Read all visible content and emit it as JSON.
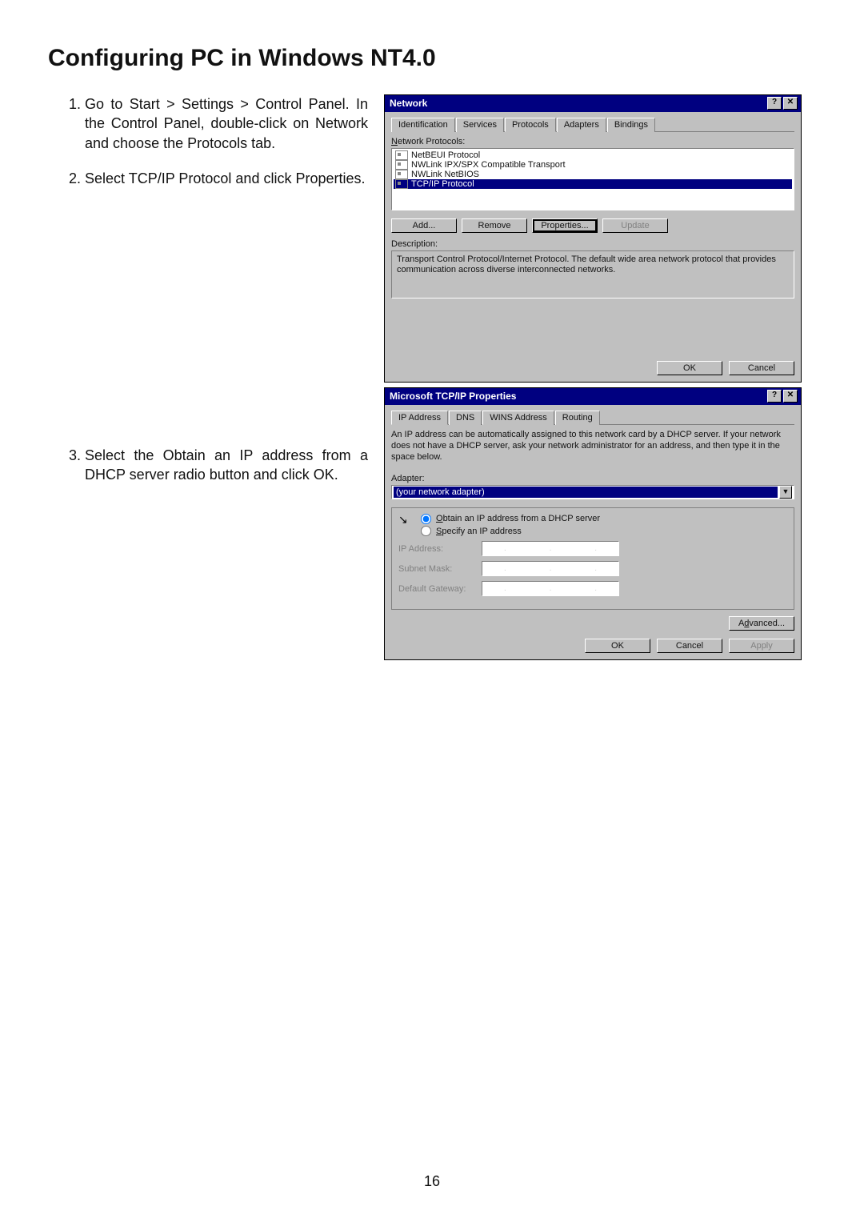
{
  "title": "Configuring PC in Windows NT4.0",
  "steps": [
    "Go to Start > Settings > Control Panel. In the Control Panel, double-click on Network and choose the Protocols tab.",
    "Select TCP/IP Protocol and click Properties.",
    "Select the Obtain an IP address from a DHCP server radio button and click OK."
  ],
  "page_number": "16",
  "network_dialog": {
    "title": "Network",
    "help_btn": "?",
    "close_btn": "✕",
    "tabs": [
      "Identification",
      "Services",
      "Protocols",
      "Adapters",
      "Bindings"
    ],
    "active_tab": 2,
    "list_label": "Network Protocols:",
    "protocols": [
      "NetBEUI Protocol",
      "NWLink IPX/SPX Compatible Transport",
      "NWLink NetBIOS",
      "TCP/IP Protocol"
    ],
    "selected_protocol": 3,
    "buttons": {
      "add": "Add...",
      "remove": "Remove",
      "properties": "Properties...",
      "update": "Update"
    },
    "desc_label": "Description:",
    "desc_text": "Transport Control Protocol/Internet Protocol. The default wide area network protocol that provides communication across diverse interconnected networks.",
    "ok": "OK",
    "cancel": "Cancel"
  },
  "tcpip_dialog": {
    "title": "Microsoft TCP/IP Properties",
    "help_btn": "?",
    "close_btn": "✕",
    "tabs": [
      "IP Address",
      "DNS",
      "WINS Address",
      "Routing"
    ],
    "active_tab": 0,
    "info_text": "An IP address can be automatically assigned to this network card by a DHCP server. If your network does not have a DHCP server, ask your network administrator for an address, and then type it in the space below.",
    "adapter_label": "Adapter:",
    "adapter_value": "(your network adapter)",
    "radio_dhcp": "Obtain an IP address from a DHCP server",
    "radio_specify": "Specify an IP address",
    "fields": {
      "ip": "IP Address:",
      "mask": "Subnet Mask:",
      "gw": "Default Gateway:"
    },
    "advanced": "Advanced...",
    "ok": "OK",
    "cancel": "Cancel",
    "apply": "Apply"
  }
}
